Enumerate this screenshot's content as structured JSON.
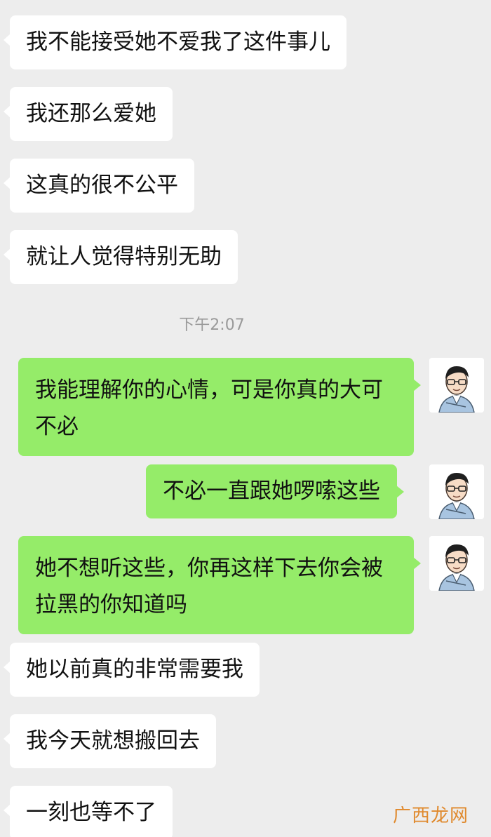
{
  "messages": {
    "m1": "我不能接受她不爱我了这件事儿",
    "m2": "我还那么爱她",
    "m3": "这真的很不公平",
    "m4": "就让人觉得特别无助",
    "timestamp": "下午2:07",
    "r1": [
      "我能理解你的心情，可是你真的大可",
      "不必"
    ],
    "r2": "不必一直跟她啰嗦这些",
    "r3": [
      "她不想听这些，你再这样下去你会被",
      "拉黑的你知道吗"
    ],
    "m5": "她以前真的非常需要我",
    "m6": "我今天就想搬回去",
    "m7": "一刻也等不了"
  },
  "avatar": {
    "icon": "cartoon-man-with-glasses-avatar"
  },
  "watermark": "广西龙网",
  "colors": {
    "background": "#ededed",
    "incoming_bubble": "#ffffff",
    "outgoing_bubble": "#95ec69",
    "watermark": "#e08a2e"
  }
}
